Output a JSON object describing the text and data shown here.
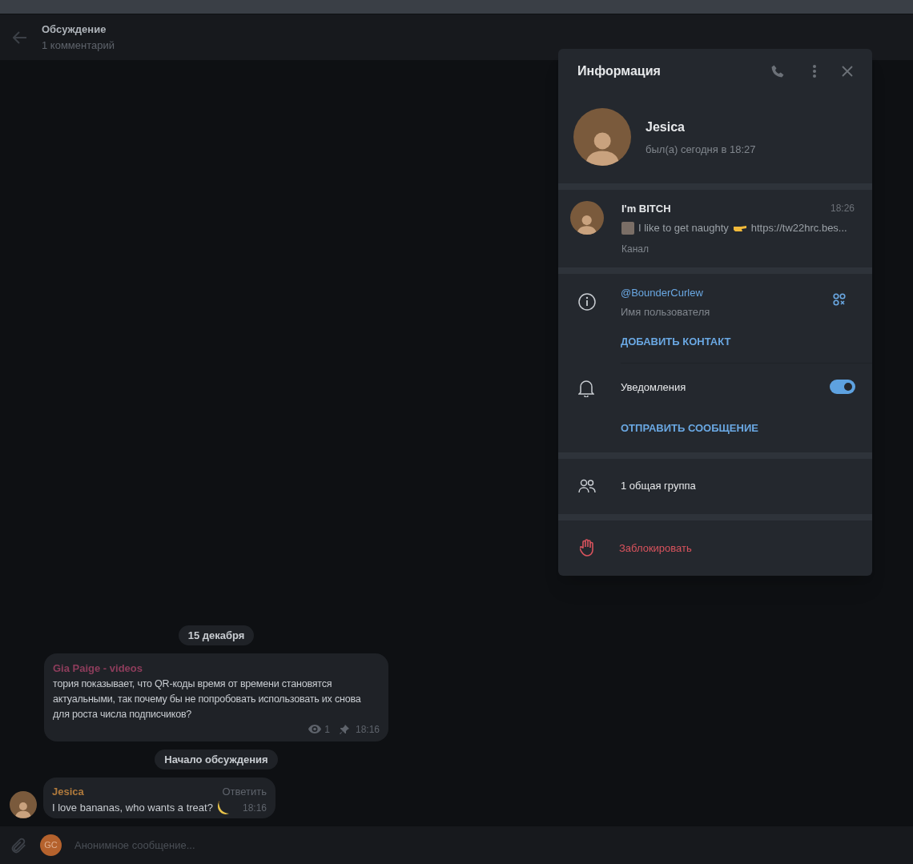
{
  "header": {
    "title": "Обсуждение",
    "subtitle": "1 комментарий"
  },
  "messages": [
    {
      "kind": "date",
      "text": "15 декабря"
    },
    {
      "kind": "post",
      "author": "Gia Paige - videos",
      "color": "#8e3d5c",
      "text": "тория показывает, что QR-коды время от времени становятся актуальными, так почему бы не попробовать использовать их снова для роста числа подписчиков?",
      "views": "1",
      "time": "18:16"
    },
    {
      "kind": "service",
      "text": "Начало обсуждения"
    },
    {
      "kind": "comment",
      "author": "Jesica",
      "color": "#b07a3c",
      "text": "I love bananas, who wants a treat?",
      "reply": "Ответить",
      "time": "18:16"
    }
  ],
  "composer": {
    "avatar_initials": "GC",
    "placeholder": "Анонимное сообщение..."
  },
  "info_panel": {
    "title": "Информация",
    "profile": {
      "name": "Jesica",
      "status": "был(а) сегодня в 18:27"
    },
    "channel": {
      "name": "I'm BITCH",
      "time": "18:26",
      "preview_text": "I like to get naughty",
      "preview_link": "https://tw22hrc.bes...",
      "label": "Канал"
    },
    "username": {
      "value": "@BounderCurlew",
      "label": "Имя пользователя",
      "action": "ДОБАВИТЬ КОНТАКТ"
    },
    "notifications": {
      "label": "Уведомления",
      "on": true,
      "action": "ОТПРАВИТЬ СООБЩЕНИЕ"
    },
    "groups": "1 общая группа",
    "block": "Заблокировать"
  }
}
